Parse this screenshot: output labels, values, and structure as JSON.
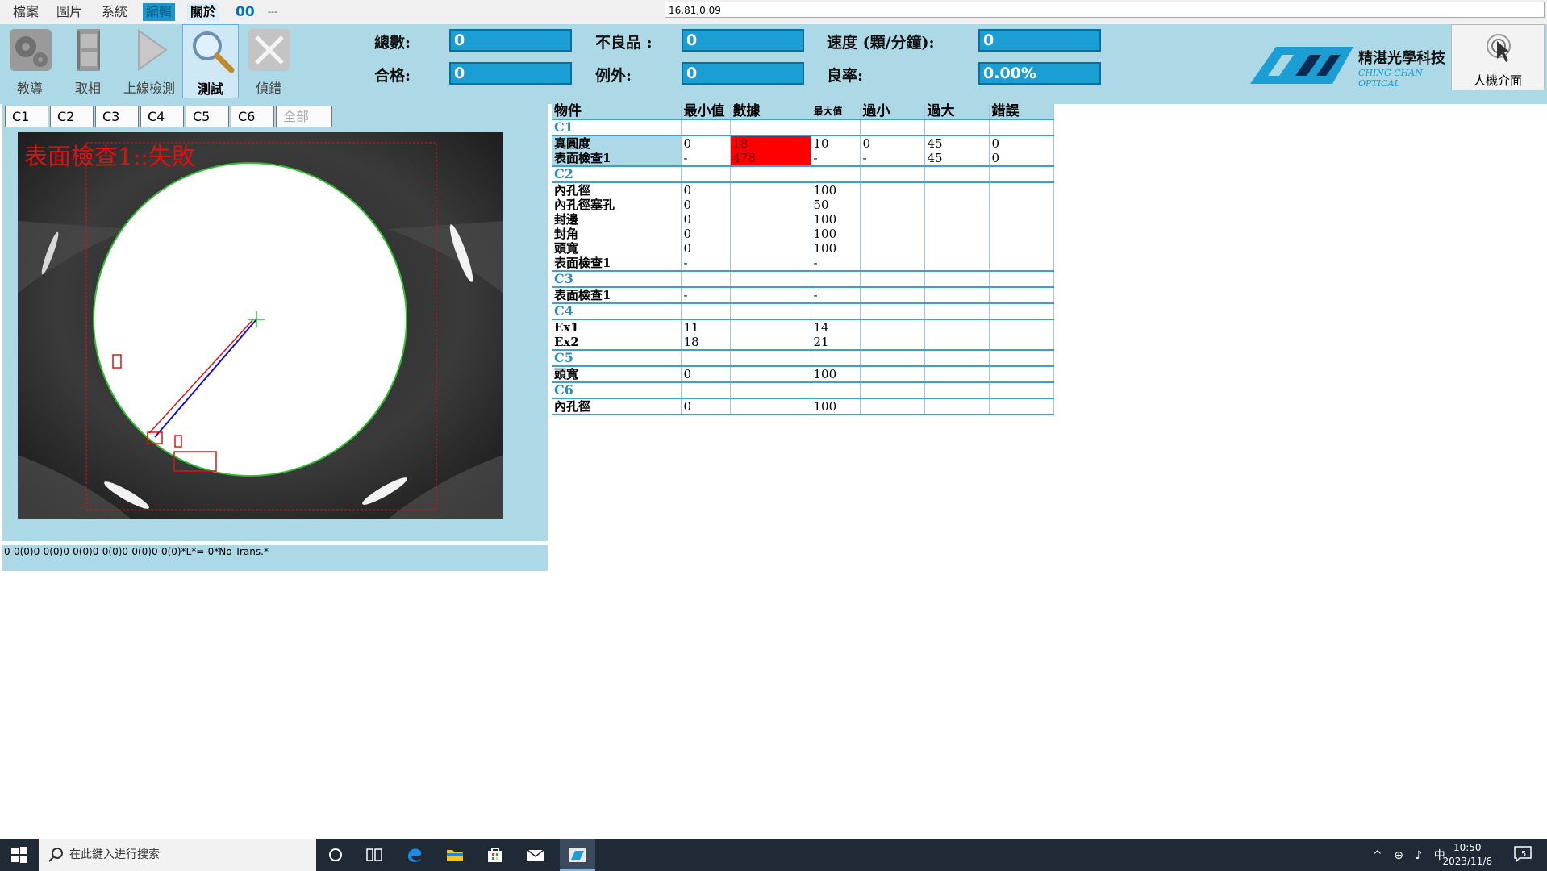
{
  "menu": {
    "items": [
      "檔案",
      "圖片",
      "系統",
      "編輯",
      "關於"
    ],
    "counter": "00",
    "dash": "---"
  },
  "coord_display": "16.81,0.09",
  "toolbar": {
    "teach": "教導",
    "capture": "取相",
    "online": "上線檢測",
    "test": "測試",
    "debug": "偵錯"
  },
  "stats": {
    "total_label": "總數:",
    "total_value": "0",
    "defect_label": "不良品 :",
    "defect_value": "0",
    "speed_label": "速度 (顆/分鐘):",
    "speed_value": "0",
    "pass_label": "合格:",
    "pass_value": "0",
    "exception_label": "例外:",
    "exception_value": "0",
    "yield_label": "良率:",
    "yield_value": "0.00%"
  },
  "logo": {
    "name_cn": "精湛光學科技",
    "name_en": "CHING CHAN OPTICAL"
  },
  "hmi_label": "人機介面",
  "tabs": [
    "C1",
    "C2",
    "C3",
    "C4",
    "C5",
    "C6",
    "全部"
  ],
  "camera": {
    "overlay_text": "表面檢查1::失敗"
  },
  "status_text": "0-0(0)0-0(0)0-0(0)0-0(0)0-0(0)0-0(0)*L*=-0*No Trans.*",
  "table": {
    "headers": [
      "物件",
      "最小值",
      "數據",
      "最大值",
      "過小",
      "過大",
      "錯誤"
    ],
    "groups": [
      {
        "name": "C1",
        "items": [
          "真圓度",
          "表面檢查1"
        ],
        "min": [
          "0",
          "-"
        ],
        "data": [
          "18",
          "478"
        ],
        "max": [
          "10",
          "-"
        ],
        "under": [
          "0",
          "-"
        ],
        "over": [
          "45",
          "45"
        ],
        "err": [
          "0",
          "0"
        ]
      },
      {
        "name": "C2",
        "items": [
          "內孔徑",
          "內孔徑塞孔",
          "封邊",
          "封角",
          "頭寬",
          "表面檢查1"
        ],
        "min": [
          "0",
          "0",
          "0",
          "0",
          "0",
          "-"
        ],
        "max": [
          "100",
          "50",
          "100",
          "100",
          "100",
          "-"
        ]
      },
      {
        "name": "C3",
        "items": [
          "表面檢查1"
        ],
        "min": [
          "-"
        ],
        "max": [
          "-"
        ]
      },
      {
        "name": "C4",
        "items": [
          "Ex1",
          "Ex2"
        ],
        "min": [
          "11",
          "18"
        ],
        "max": [
          "14",
          "21"
        ]
      },
      {
        "name": "C5",
        "items": [
          "頭寬"
        ],
        "min": [
          "0"
        ],
        "max": [
          "100"
        ]
      },
      {
        "name": "C6",
        "items": [
          "內孔徑"
        ],
        "min": [
          "0"
        ],
        "max": [
          "100"
        ]
      }
    ]
  },
  "taskbar": {
    "search_placeholder": "在此鍵入进行搜索",
    "ime": "中",
    "time": "10:50",
    "date": "2023/11/6",
    "notifications": "5"
  },
  "colors": {
    "panel": "#add8e6",
    "value_box": "#1a9ed4",
    "fail_text": "#e01010",
    "error_cell": "#ff0000",
    "group_text": "#2b8bc0"
  }
}
